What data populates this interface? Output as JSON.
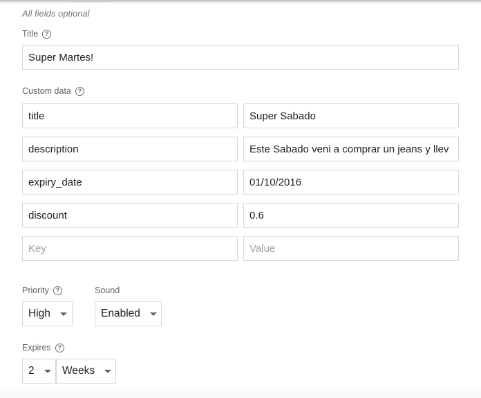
{
  "hint": "All fields optional",
  "title_field": {
    "label": "Title",
    "value": "Super Martes!"
  },
  "custom_data": {
    "label": "Custom data",
    "rows": [
      {
        "key": "title",
        "value": "Super Sabado"
      },
      {
        "key": "description",
        "value": "Este Sabado veni a comprar un jeans y llev"
      },
      {
        "key": "expiry_date",
        "value": "01/10/2016"
      },
      {
        "key": "discount",
        "value": "0.6"
      }
    ],
    "key_placeholder": "Key",
    "value_placeholder": "Value"
  },
  "priority": {
    "label": "Priority",
    "selected": "High"
  },
  "sound": {
    "label": "Sound",
    "selected": "Enabled"
  },
  "expires": {
    "label": "Expires",
    "amount": "2",
    "unit": "Weeks"
  },
  "icons": {
    "help": "help-circle-icon",
    "dropdown": "chevron-down-icon"
  }
}
